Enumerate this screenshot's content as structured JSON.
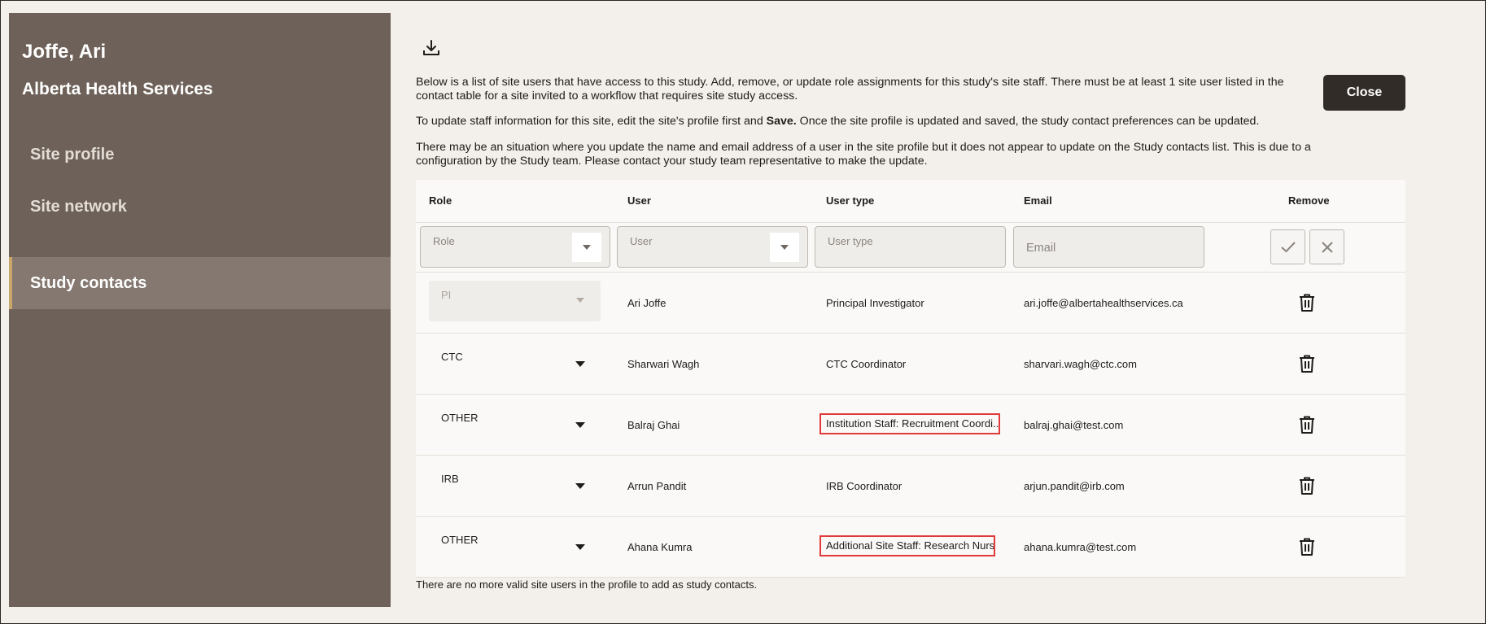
{
  "sidebar": {
    "name": "Joffe, Ari",
    "organization": "Alberta Health Services",
    "items": [
      {
        "label": "Site profile"
      },
      {
        "label": "Site network"
      },
      {
        "label": "Study contacts"
      }
    ],
    "active_item": "Study contacts"
  },
  "toolbar": {
    "download_icon": "download-icon",
    "close_label": "Close"
  },
  "intro": {
    "p1": "Below is a list of site users that have access to this study. Add, remove, or update role assignments for this study's site staff. There must be at least 1 site user listed in the contact table for a site invited to a workflow that requires site study access.",
    "p2_before": "To update staff information for this site, edit the site's profile first and ",
    "p2_bold": "Save.",
    "p2_after": " Once the site profile is updated and saved, the study contact preferences can be updated.",
    "p3": "There may be an situation where you update the name and email address of a user in the site profile but it does not appear to update on the Study contacts list. This is due to a configuration by the Study team. Please contact your study team representative to make the update."
  },
  "table": {
    "headers": {
      "role": "Role",
      "user": "User",
      "user_type": "User type",
      "email": "Email",
      "remove": "Remove"
    },
    "filters": {
      "role_placeholder": "Role",
      "user_placeholder": "User",
      "user_type_placeholder": "User type",
      "email_placeholder": "Email"
    },
    "rows": [
      {
        "role": "PI",
        "user": "Ari Joffe",
        "user_type": "Principal Investigator",
        "email": "ari.joffe@albertahealthservices.ca",
        "role_disabled": true,
        "highlighted": false
      },
      {
        "role": "CTC",
        "user": "Sharwari Wagh",
        "user_type": "CTC Coordinator",
        "email": "sharvari.wagh@ctc.com",
        "role_disabled": false,
        "highlighted": false
      },
      {
        "role": "OTHER",
        "user": "Balraj Ghai",
        "user_type": "Institution Staff: Recruitment Coordi...",
        "email": "balraj.ghai@test.com",
        "role_disabled": false,
        "highlighted": true
      },
      {
        "role": "IRB",
        "user": "Arrun Pandit",
        "user_type": "IRB Coordinator",
        "email": "arjun.pandit@irb.com",
        "role_disabled": false,
        "highlighted": false
      },
      {
        "role": "OTHER",
        "user": "Ahana Kumra",
        "user_type": "Additional Site Staff: Research Nurse",
        "email": "ahana.kumra@test.com",
        "role_disabled": false,
        "highlighted": true
      }
    ],
    "footnote": "There are no more valid site users in the profile to add as study contacts."
  },
  "colors": {
    "sidebar_bg": "#6e6159",
    "sidebar_active": "#847870",
    "close_button": "#312c28",
    "highlight_border": "#e03a3a"
  }
}
